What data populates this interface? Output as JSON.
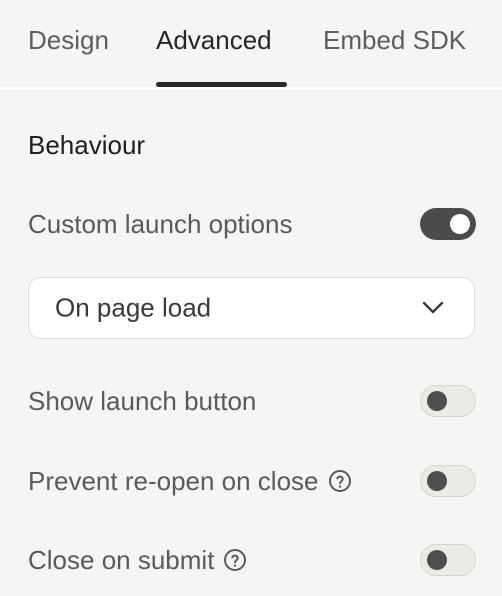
{
  "tabs": [
    {
      "label": "Design",
      "active": false
    },
    {
      "label": "Advanced",
      "active": true
    },
    {
      "label": "Embed SDK",
      "active": false
    }
  ],
  "section": {
    "title": "Behaviour"
  },
  "settings": {
    "custom_launch": {
      "label": "Custom launch options",
      "enabled": true
    },
    "launch_trigger": {
      "value": "On page load",
      "icon": "chevron-down-icon"
    },
    "show_launch_button": {
      "label": "Show launch button",
      "enabled": false
    },
    "prevent_reopen": {
      "label": "Prevent re-open on close",
      "enabled": false,
      "help_icon": "help-circle-icon"
    },
    "close_on_submit": {
      "label": "Close on submit",
      "enabled": false,
      "help_icon": "help-circle-icon"
    }
  },
  "colors": {
    "background": "#f6f5f3",
    "toggle_on": "#4b4b4b",
    "toggle_off": "#ebeae7",
    "text_primary": "#1f1f1f",
    "text_secondary": "#5a5a5a"
  }
}
